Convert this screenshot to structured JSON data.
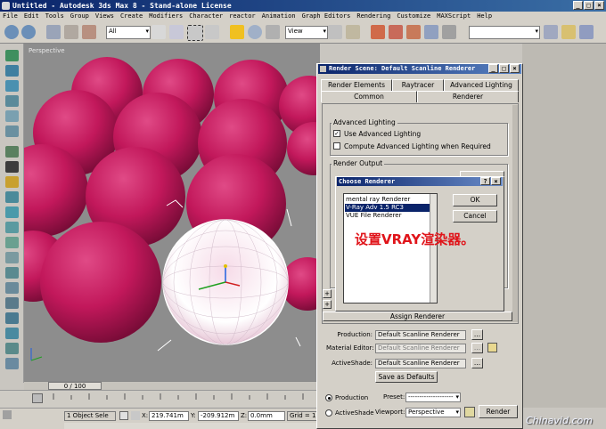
{
  "window": {
    "title": "Untitled - Autodesk 3ds Max 8 - Stand-alone License"
  },
  "menu": [
    "File",
    "Edit",
    "Tools",
    "Group",
    "Views",
    "Create",
    "Modifiers",
    "Character",
    "reactor",
    "Animation",
    "Graph Editors",
    "Rendering",
    "Customize",
    "MAXScript",
    "Help"
  ],
  "toolbar": {
    "selection_filter": "All",
    "reference_coord": "View"
  },
  "viewport": {
    "label": "Perspective"
  },
  "timeline": {
    "frame_counter": "0 / 100"
  },
  "status": {
    "selection": "1 Object Sele",
    "x_label": "X:",
    "x_value": "219.741m",
    "y_label": "Y:",
    "y_value": "-209.912m",
    "z_label": "Z:",
    "z_value": "0.0mm",
    "grid_label": "Grid = 10.0"
  },
  "render_scene": {
    "title": "Render Scene: Default Scanline Renderer",
    "tabs_row1": [
      "Render Elements",
      "Raytracer",
      "Advanced Lighting"
    ],
    "tabs_row2": [
      "Common",
      "Renderer"
    ],
    "adv_lighting_group": "Advanced Lighting",
    "use_adv_lighting": "Use Advanced Lighting",
    "use_adv_lighting_checked": true,
    "compute_adv_lighting": "Compute Advanced Lighting when Required",
    "compute_adv_lighting_checked": false,
    "render_output_group": "Render Output",
    "assign_renderer": "Assign Renderer",
    "production_label": "Production:",
    "production_value": "Default Scanline Renderer",
    "material_editor_label": "Material Editor:",
    "material_editor_value": "Default Scanline Renderer",
    "activeshade_label": "ActiveShade:",
    "activeshade_value": "Default Scanline Renderer",
    "browse_button": "...",
    "save_as_defaults": "Save as Defaults",
    "mode_production": "Production",
    "mode_activeshade": "ActiveShade",
    "preset_label": "Preset:",
    "preset_value": "--------------------",
    "viewport_label": "Viewport:",
    "viewport_value": "Perspective",
    "render_button": "Render"
  },
  "choose_renderer": {
    "title": "Choose Renderer",
    "items": [
      "mental ray Renderer",
      "V-Ray Adv 1.5 RC3",
      "VUE File Renderer"
    ],
    "selected_index": 1,
    "ok": "OK",
    "cancel": "Cancel"
  },
  "annotation": "设置VRAY渲染器。",
  "watermark": "Chinavid.com",
  "colors": {
    "sphere": "#c2185b",
    "viewport_bg": "#8d8d8d",
    "title_bar": "#0a246a",
    "annotation": "#e0141a"
  }
}
